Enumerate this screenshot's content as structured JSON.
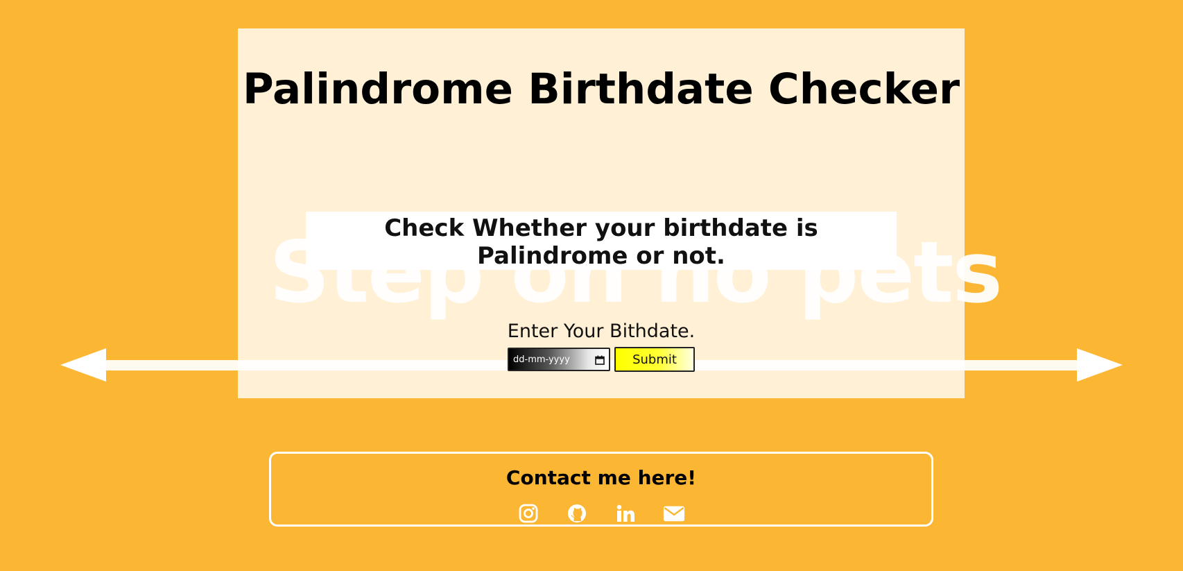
{
  "header": {
    "title": "Palindrome Birthdate Checker"
  },
  "main": {
    "subtitle": "Check Whether your birthdate is Palindrome or not.",
    "background_watermark": "Step on no pets",
    "form": {
      "label": "Enter Your Bithdate.",
      "date_placeholder": "dd-mm-yyyy",
      "submit_label": "Submit"
    }
  },
  "contact": {
    "heading": "Contact me here!",
    "links": [
      {
        "icon": "instagram-icon"
      },
      {
        "icon": "github-icon"
      },
      {
        "icon": "linkedin-icon"
      },
      {
        "icon": "envelope-icon"
      }
    ]
  },
  "colors": {
    "background": "#fbb734",
    "card": "#fff0d6",
    "submit_button": "#ffff00"
  }
}
